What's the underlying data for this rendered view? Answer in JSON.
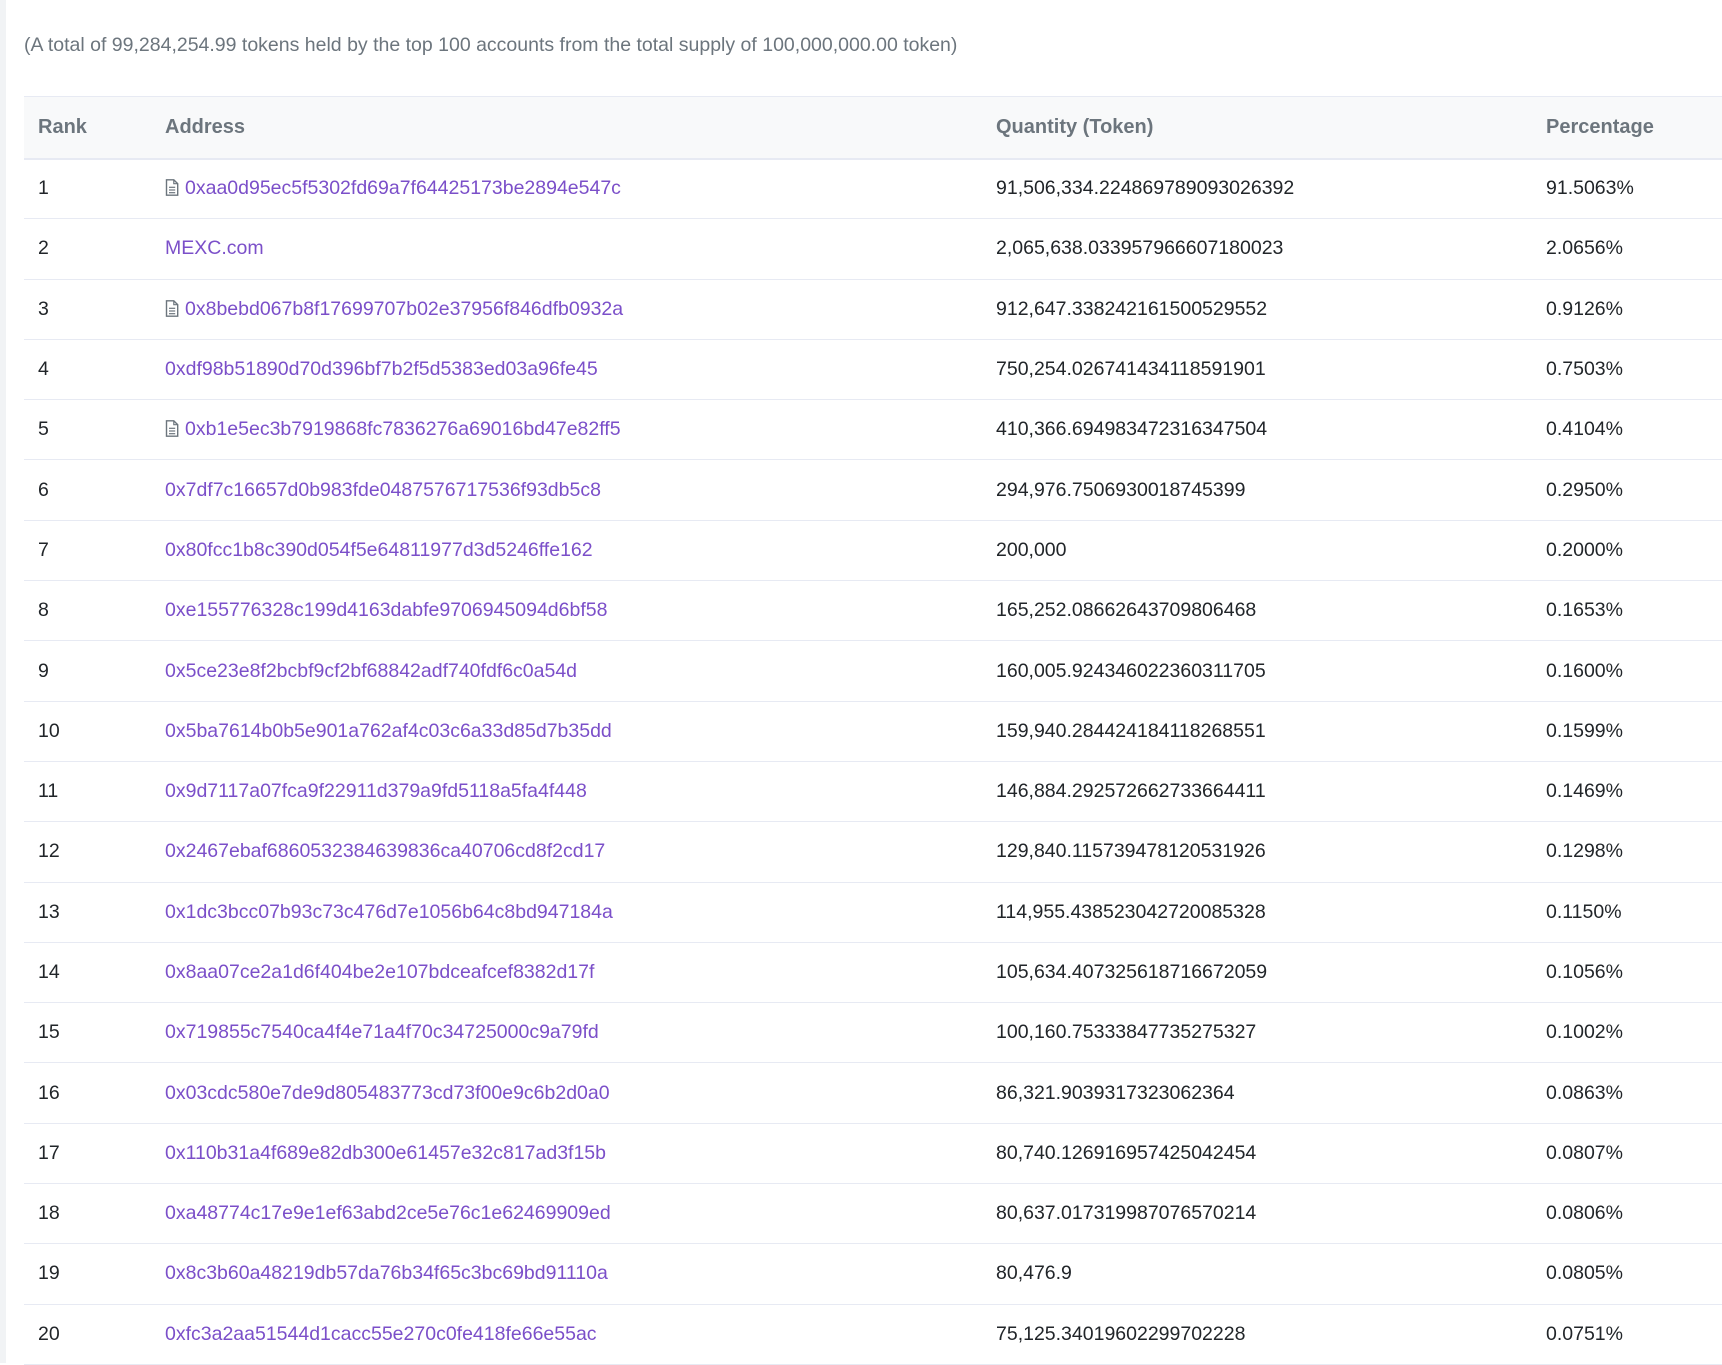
{
  "summary": "(A total of 99,284,254.99 tokens held by the top 100 accounts from the total supply of 100,000,000.00 token)",
  "table": {
    "headers": {
      "rank": "Rank",
      "address": "Address",
      "quantity": "Quantity (Token)",
      "percentage": "Percentage"
    },
    "rows": [
      {
        "rank": "1",
        "address": "0xaa0d95ec5f5302fd69a7f64425173be2894e547c",
        "contract": true,
        "quantity": "91,506,334.224869789093026392",
        "percentage": "91.5063%"
      },
      {
        "rank": "2",
        "address": "MEXC.com",
        "contract": false,
        "quantity": "2,065,638.033957966607180023",
        "percentage": "2.0656%"
      },
      {
        "rank": "3",
        "address": "0x8bebd067b8f17699707b02e37956f846dfb0932a",
        "contract": true,
        "quantity": "912,647.338242161500529552",
        "percentage": "0.9126%"
      },
      {
        "rank": "4",
        "address": "0xdf98b51890d70d396bf7b2f5d5383ed03a96fe45",
        "contract": false,
        "quantity": "750,254.026741434118591901",
        "percentage": "0.7503%"
      },
      {
        "rank": "5",
        "address": "0xb1e5ec3b7919868fc7836276a69016bd47e82ff5",
        "contract": true,
        "quantity": "410,366.694983472316347504",
        "percentage": "0.4104%"
      },
      {
        "rank": "6",
        "address": "0x7df7c16657d0b983fde0487576717536f93db5c8",
        "contract": false,
        "quantity": "294,976.7506930018745399",
        "percentage": "0.2950%"
      },
      {
        "rank": "7",
        "address": "0x80fcc1b8c390d054f5e64811977d3d5246ffe162",
        "contract": false,
        "quantity": "200,000",
        "percentage": "0.2000%"
      },
      {
        "rank": "8",
        "address": "0xe155776328c199d4163dabfe9706945094d6bf58",
        "contract": false,
        "quantity": "165,252.08662643709806468",
        "percentage": "0.1653%"
      },
      {
        "rank": "9",
        "address": "0x5ce23e8f2bcbf9cf2bf68842adf740fdf6c0a54d",
        "contract": false,
        "quantity": "160,005.924346022360311705",
        "percentage": "0.1600%"
      },
      {
        "rank": "10",
        "address": "0x5ba7614b0b5e901a762af4c03c6a33d85d7b35dd",
        "contract": false,
        "quantity": "159,940.284424184118268551",
        "percentage": "0.1599%"
      },
      {
        "rank": "11",
        "address": "0x9d7117a07fca9f22911d379a9fd5118a5fa4f448",
        "contract": false,
        "quantity": "146,884.292572662733664411",
        "percentage": "0.1469%"
      },
      {
        "rank": "12",
        "address": "0x2467ebaf6860532384639836ca40706cd8f2cd17",
        "contract": false,
        "quantity": "129,840.115739478120531926",
        "percentage": "0.1298%"
      },
      {
        "rank": "13",
        "address": "0x1dc3bcc07b93c73c476d7e1056b64c8bd947184a",
        "contract": false,
        "quantity": "114,955.438523042720085328",
        "percentage": "0.1150%"
      },
      {
        "rank": "14",
        "address": "0x8aa07ce2a1d6f404be2e107bdceafcef8382d17f",
        "contract": false,
        "quantity": "105,634.407325618716672059",
        "percentage": "0.1056%"
      },
      {
        "rank": "15",
        "address": "0x719855c7540ca4f4e71a4f70c34725000c9a79fd",
        "contract": false,
        "quantity": "100,160.75333847735275327",
        "percentage": "0.1002%"
      },
      {
        "rank": "16",
        "address": "0x03cdc580e7de9d805483773cd73f00e9c6b2d0a0",
        "contract": false,
        "quantity": "86,321.9039317323062364",
        "percentage": "0.0863%"
      },
      {
        "rank": "17",
        "address": "0x110b31a4f689e82db300e61457e32c817ad3f15b",
        "contract": false,
        "quantity": "80,740.126916957425042454",
        "percentage": "0.0807%"
      },
      {
        "rank": "18",
        "address": "0xa48774c17e9e1ef63abd2ce5e76c1e62469909ed",
        "contract": false,
        "quantity": "80,637.017319987076570214",
        "percentage": "0.0806%"
      },
      {
        "rank": "19",
        "address": "0x8c3b60a48219db57da76b34f65c3bc69bd91110a",
        "contract": false,
        "quantity": "80,476.9",
        "percentage": "0.0805%"
      },
      {
        "rank": "20",
        "address": "0xfc3a2aa51544d1cacc55e270c0fe418fe66e55ac",
        "contract": false,
        "quantity": "75,125.34019602299702228",
        "percentage": "0.0751%"
      }
    ]
  },
  "colors": {
    "link": "#7b4fc9",
    "header_text": "#6c757d",
    "row_border": "#e7eaf3"
  },
  "icons": {
    "contract": "file-document-icon"
  }
}
